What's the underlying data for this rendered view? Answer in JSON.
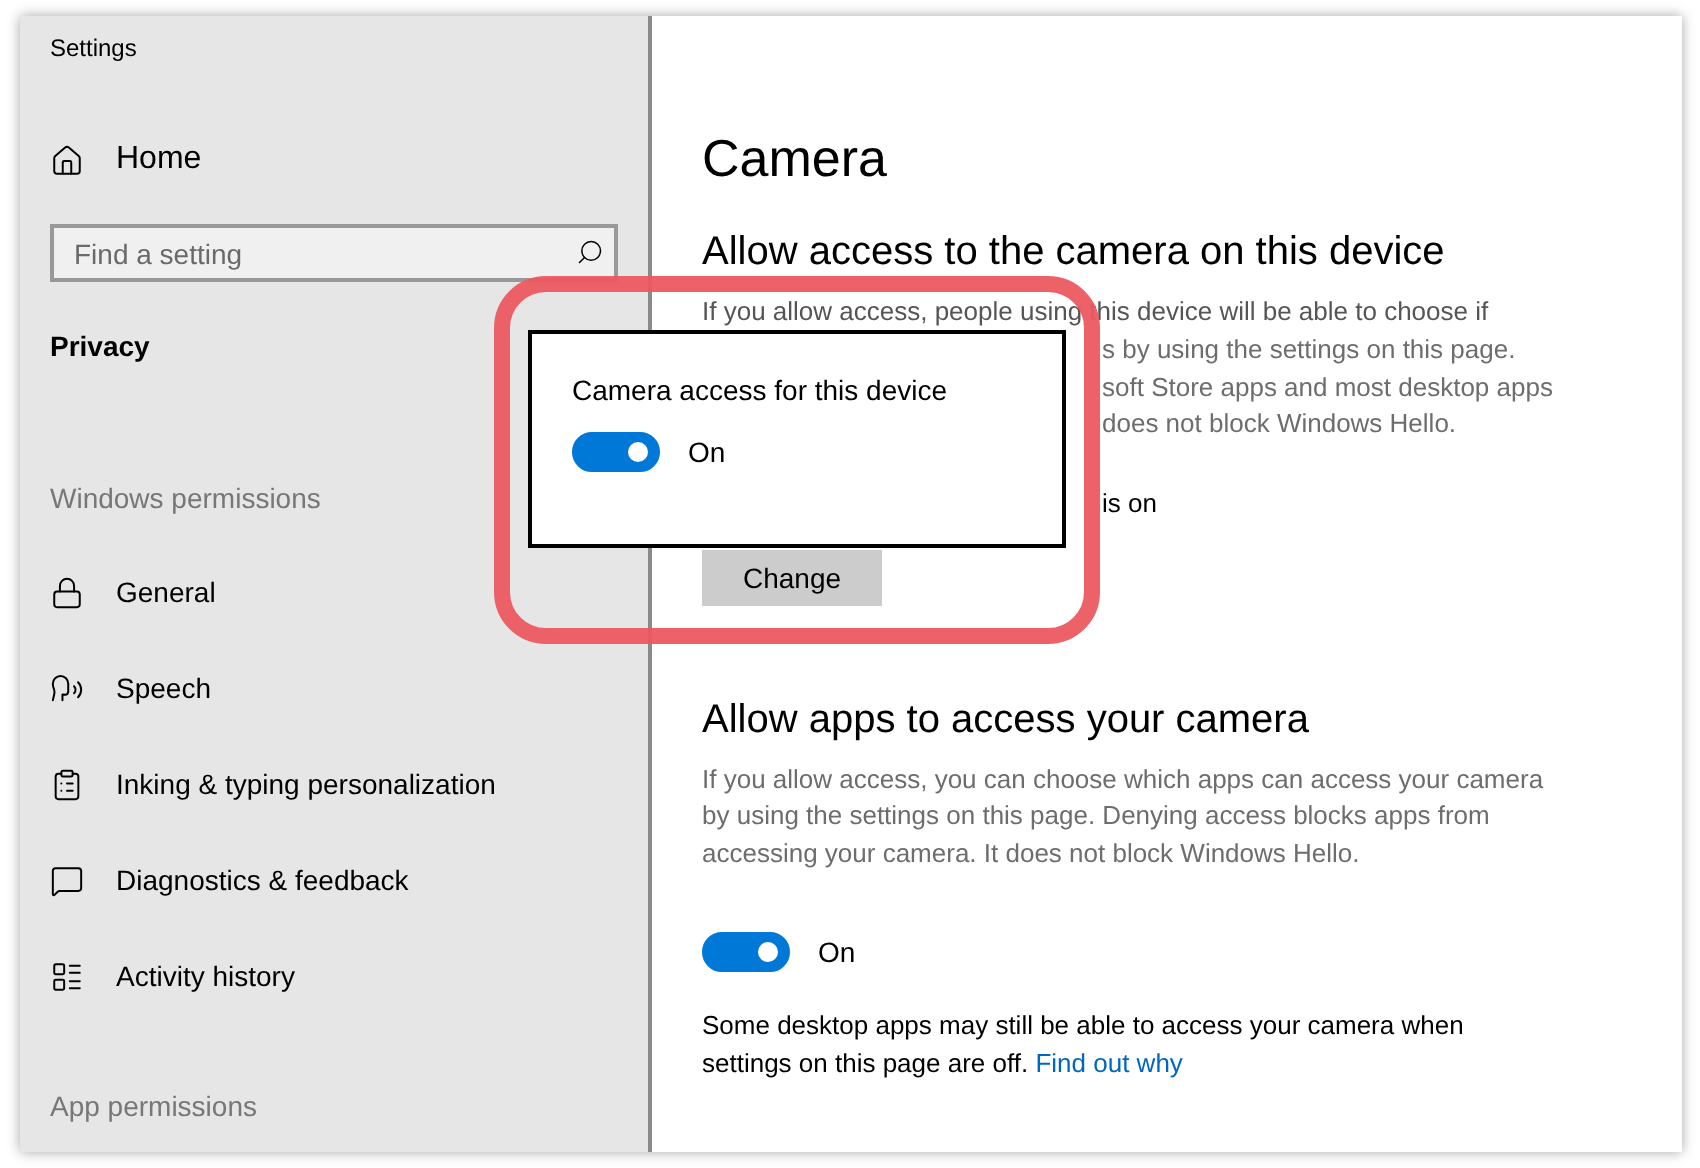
{
  "window": {
    "title": "Settings"
  },
  "sidebar": {
    "home": "Home",
    "search": {
      "placeholder": "Find a setting"
    },
    "section": "Privacy",
    "group_heading": "Windows permissions",
    "items": [
      {
        "label": "General",
        "selected": false
      },
      {
        "label": "Speech",
        "selected": false
      },
      {
        "label": "Inking & typing personalization",
        "selected": false
      },
      {
        "label": "Diagnostics & feedback",
        "selected": false
      },
      {
        "label": "Activity history",
        "selected": false
      }
    ],
    "footer_heading": "App permissions"
  },
  "content": {
    "title": "Camera",
    "device_section": {
      "heading": "Allow access to the camera on this device",
      "first_line": "If you allow access, people using this device will be able to choose if",
      "visible_fragments": [
        "s by using the settings on this page.",
        "soft Store apps and most desktop apps",
        "does not block Windows Hello."
      ],
      "status_fragment": "is on",
      "button": "Change"
    },
    "apps_section": {
      "heading": "Allow apps to access your camera",
      "description": "If you allow access, you can choose which apps can access your camera by using the settings on this page. Denying access blocks apps from accessing your camera. It does not block Windows Hello.",
      "toggle": {
        "on": true,
        "label": "On"
      },
      "note": "Some desktop apps may still be able to access your camera when settings on this page are off.",
      "link": "Find out why"
    }
  },
  "popup": {
    "title": "Camera access for this device",
    "toggle": {
      "on": true,
      "label": "On"
    }
  }
}
